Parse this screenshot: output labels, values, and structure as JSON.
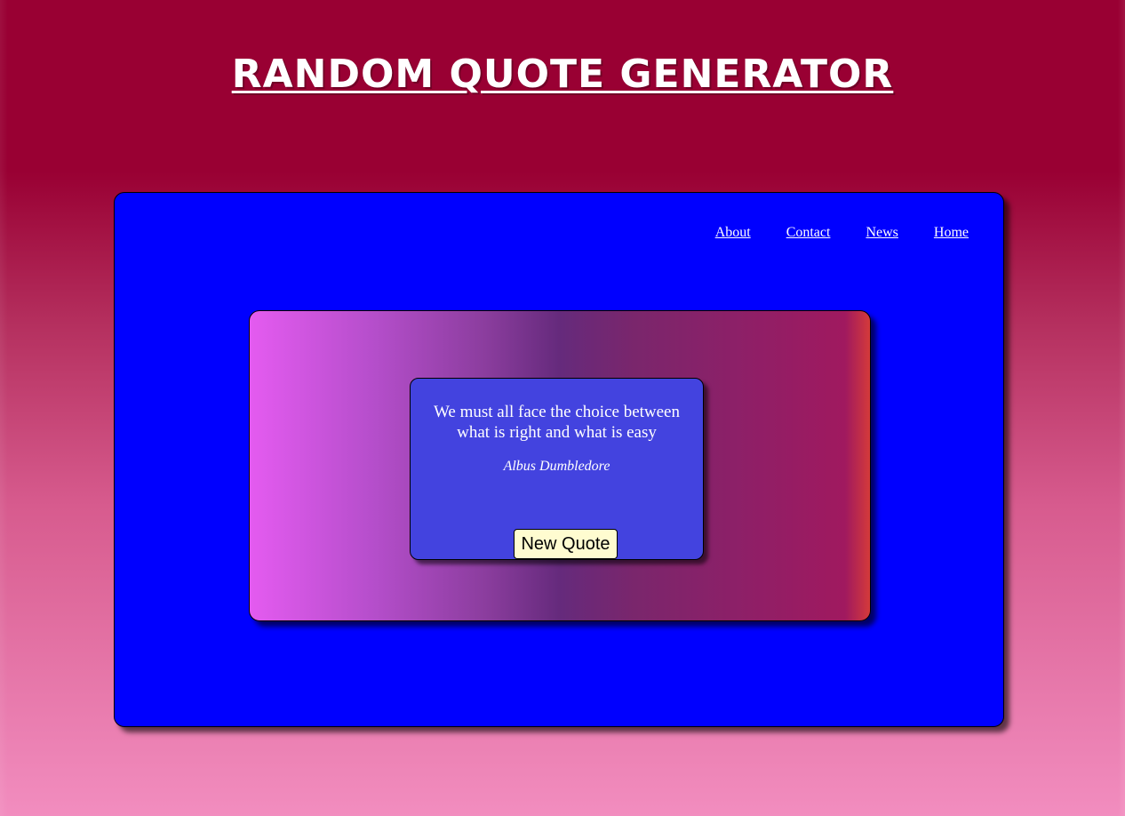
{
  "header": {
    "title": "Random Quote Generator"
  },
  "nav": {
    "items": [
      {
        "label": "About"
      },
      {
        "label": "Contact"
      },
      {
        "label": "News"
      },
      {
        "label": "Home"
      }
    ]
  },
  "quote": {
    "text": "We must all face the choice between what is right and what is easy",
    "author": "Albus Dumbledore",
    "button_label": "New Quote"
  },
  "colors": {
    "page_top": "#990033",
    "page_bottom": "#f28dbf",
    "outer_panel": "#0000ff",
    "quote_card": "#4343df",
    "button_bg": "#fffcd0",
    "text": "#ffffff"
  }
}
